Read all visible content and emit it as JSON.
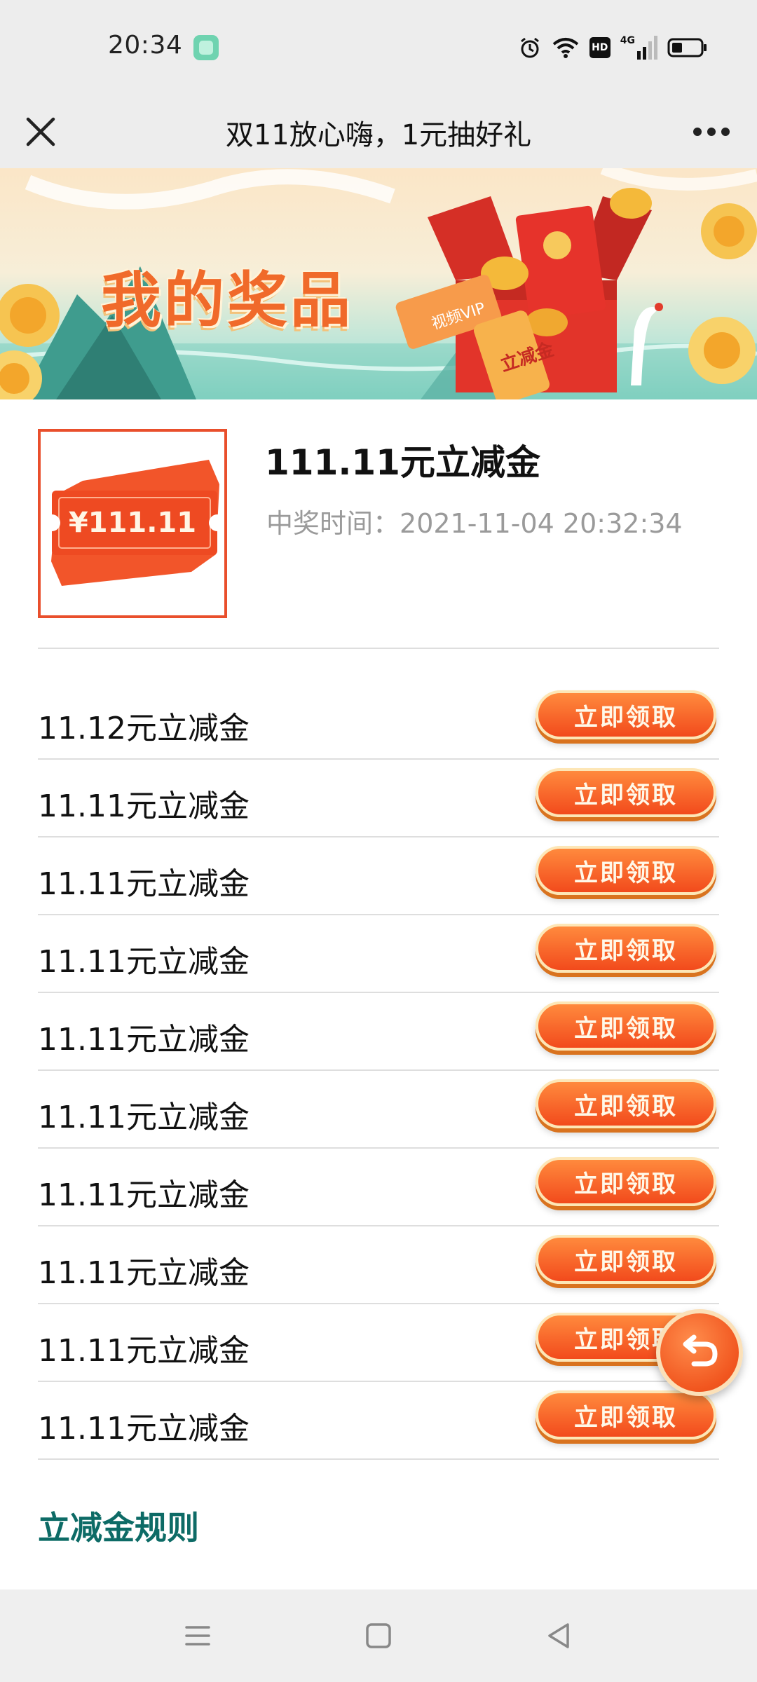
{
  "status_bar": {
    "time": "20:34",
    "hd_label": "HD",
    "network_label": "4G",
    "icons": [
      "app-notification-icon",
      "alarm-icon",
      "wifi-icon",
      "hd-icon",
      "signal-4g-icon",
      "battery-icon"
    ]
  },
  "title_bar": {
    "title": "双11放心嗨，1元抽好礼",
    "close_icon": "close-icon",
    "more_icon": "more-icon"
  },
  "banner": {
    "title": "我的奖品",
    "ticket_label": "视频VIP",
    "envelope_label": "立减金"
  },
  "prize": {
    "thumb_amount": "¥111.11",
    "name": "111.11元立减金",
    "time_label": "中奖时间：",
    "time_value": "2021-11-04 20:32:34"
  },
  "coupons": [
    {
      "label": "11.12元立减金",
      "button": "立即领取"
    },
    {
      "label": "11.11元立减金",
      "button": "立即领取"
    },
    {
      "label": "11.11元立减金",
      "button": "立即领取"
    },
    {
      "label": "11.11元立减金",
      "button": "立即领取"
    },
    {
      "label": "11.11元立减金",
      "button": "立即领取"
    },
    {
      "label": "11.11元立减金",
      "button": "立即领取"
    },
    {
      "label": "11.11元立减金",
      "button": "立即领取"
    },
    {
      "label": "11.11元立减金",
      "button": "立即领取"
    },
    {
      "label": "11.11元立减金",
      "button": "立即领取"
    },
    {
      "label": "11.11元立减金",
      "button": "立即领取"
    }
  ],
  "rules_link": "立减金规则",
  "colors": {
    "accent_orange": "#f24a1c",
    "link_teal": "#0d6b66",
    "chrome_gray": "#ededed"
  },
  "nav_bar": {
    "icons": [
      "menu-icon",
      "home-icon",
      "back-icon"
    ]
  }
}
